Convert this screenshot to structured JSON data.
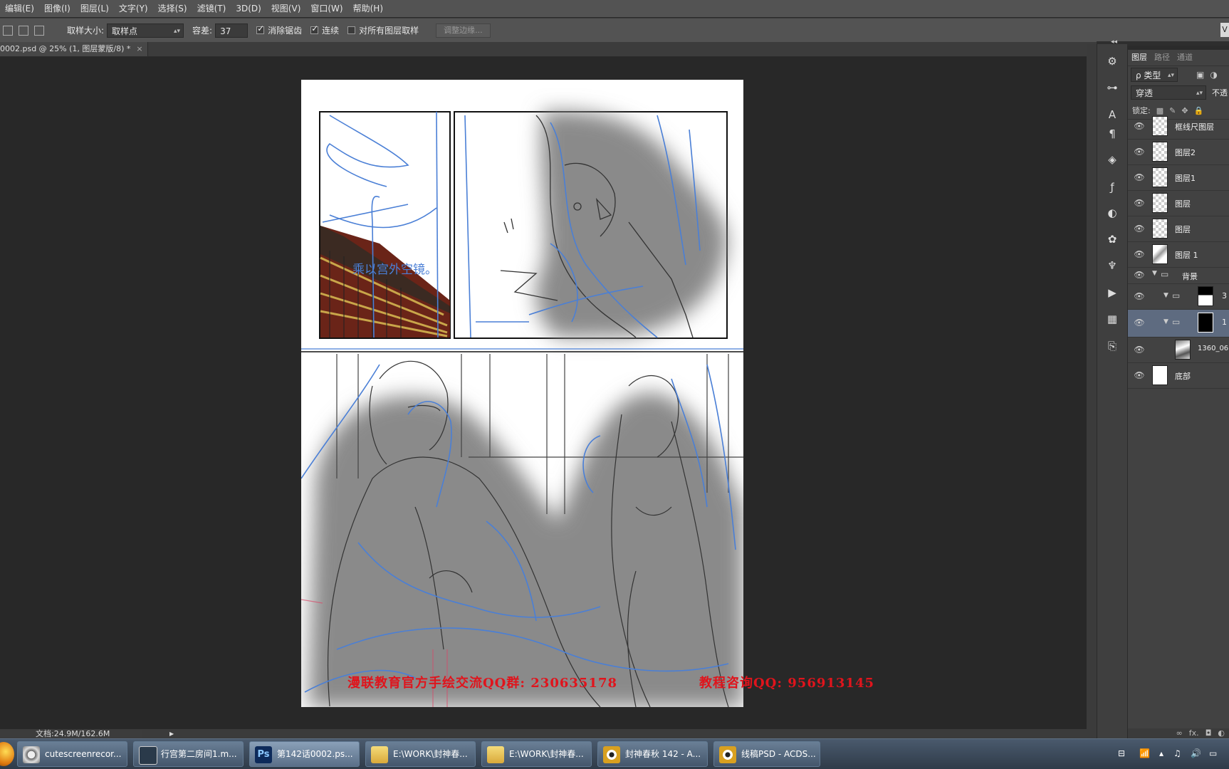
{
  "menu": [
    "编辑(E)",
    "图像(I)",
    "图层(L)",
    "文字(Y)",
    "选择(S)",
    "滤镜(T)",
    "3D(D)",
    "视图(V)",
    "窗口(W)",
    "帮助(H)"
  ],
  "options": {
    "sample_size_label": "取样大小:",
    "sample_size_value": "取样点",
    "tolerance_label": "容差:",
    "tolerance_value": "37",
    "antialias_label": "消除锯齿",
    "contiguous_label": "连续",
    "all_layers_label": "对所有图层取样",
    "refine_edge_label": "调整边缘...",
    "corner_label": "V"
  },
  "document": {
    "tab_title": "0002.psd @ 25% (1, 图层蒙版/8) *",
    "close_glyph": "×",
    "panel_caption": "乘以宫外空镜。"
  },
  "watermark": {
    "left": "漫联教育官方手绘交流QQ群: 230635178",
    "right": "教程咨询QQ: 956913145"
  },
  "status": {
    "doc_size": "文档:24.9M/162.6M",
    "arrow": "▶"
  },
  "collapse_glyph": "◂◂",
  "layers_panel": {
    "tabs": [
      "图层",
      "路径",
      "通道"
    ],
    "filter_label": "ρ 类型",
    "blend_mode": "穿透",
    "opacity_label": "不透",
    "lock_label": "锁定:",
    "layers": [
      {
        "name": "框线尺图层",
        "thumb": "checker",
        "indent": 0
      },
      {
        "name": "图层2",
        "thumb": "checker",
        "indent": 0
      },
      {
        "name": "图层1",
        "thumb": "checker",
        "indent": 0
      },
      {
        "name": "图层",
        "thumb": "checker",
        "indent": 0
      },
      {
        "name": "图层",
        "thumb": "checker",
        "indent": 0
      },
      {
        "name": "图层 1",
        "thumb": "sketch",
        "indent": 0
      },
      {
        "name": "背景",
        "thumb": "group",
        "indent": 0
      },
      {
        "name": "3",
        "thumb": "mask-white",
        "indent": 1
      },
      {
        "name": "1",
        "thumb": "mask-black",
        "indent": 1,
        "selected": true
      },
      {
        "name": "1360_06",
        "thumb": "photo",
        "indent": 2
      },
      {
        "name": "底部",
        "thumb": "white",
        "indent": 0
      }
    ],
    "footer_icons": [
      "∞",
      "fx.",
      "◘",
      "◐"
    ]
  },
  "taskbar": {
    "items": [
      {
        "label": "cutescreenrecor...",
        "icon": "film-reel-icon",
        "color": "#bfbfbf"
      },
      {
        "label": "行宫第二房间1.m...",
        "icon": "maya-icon",
        "color": "#2a3a4a"
      },
      {
        "label": "第142话0002.ps...",
        "icon": "photoshop-icon",
        "color": "#0d2a5a",
        "active": true
      },
      {
        "label": "E:\\WORK\\封神春...",
        "icon": "folder-icon",
        "color": "#e8c35a"
      },
      {
        "label": "E:\\WORK\\封神春...",
        "icon": "folder-icon",
        "color": "#e8c35a"
      },
      {
        "label": "封神春秋 142 - A...",
        "icon": "acdsee-eye-icon",
        "color": "#d8a020"
      },
      {
        "label": "线稿PSD - ACDS...",
        "icon": "acdsee-eye-icon",
        "color": "#d8a020"
      }
    ],
    "tray": [
      "⊟",
      "📶",
      "▴",
      "♫",
      "🔊",
      "▭"
    ]
  },
  "colors": {
    "chrome": "#535353",
    "canvas_bg": "#282828",
    "panel": "#424242",
    "selection": "#5e6b80",
    "sketch_blue": "#4a7fd6",
    "shadow_gray": "#8a8a8a",
    "watermark_red": "#e0141c"
  }
}
